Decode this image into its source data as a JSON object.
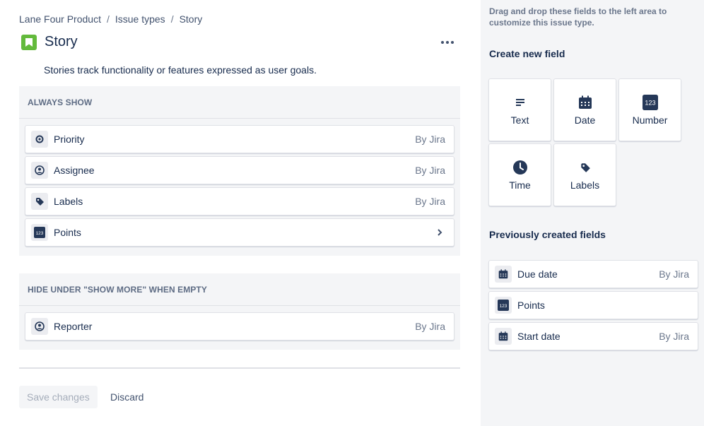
{
  "breadcrumb": {
    "items": [
      "Lane Four Product",
      "Issue types",
      "Story"
    ],
    "separator": "/"
  },
  "header": {
    "title": "Story",
    "description": "Stories track functionality or features expressed as user goals."
  },
  "always_show": {
    "heading": "ALWAYS SHOW",
    "fields": [
      {
        "name": "Priority",
        "meta": "By Jira",
        "icon": "priority-icon"
      },
      {
        "name": "Assignee",
        "meta": "By Jira",
        "icon": "user-icon"
      },
      {
        "name": "Labels",
        "meta": "By Jira",
        "icon": "label-icon"
      },
      {
        "name": "Points",
        "meta": "",
        "icon": "number-icon"
      }
    ]
  },
  "hide_section": {
    "heading": "HIDE UNDER \"SHOW MORE\" WHEN EMPTY",
    "fields": [
      {
        "name": "Reporter",
        "meta": "By Jira",
        "icon": "user-icon"
      }
    ]
  },
  "actions": {
    "save": "Save changes",
    "discard": "Discard"
  },
  "sidebar": {
    "hint": "Drag and drop these fields to the left area to customize this issue type.",
    "create_heading": "Create new field",
    "create_types": [
      {
        "label": "Text",
        "icon": "text-icon"
      },
      {
        "label": "Date",
        "icon": "calendar-icon"
      },
      {
        "label": "Number",
        "icon": "number-icon",
        "badge": "123"
      },
      {
        "label": "Time",
        "icon": "clock-icon"
      },
      {
        "label": "Labels",
        "icon": "label-icon"
      }
    ],
    "previous_heading": "Previously created fields",
    "previous_fields": [
      {
        "name": "Due date",
        "meta": "By Jira",
        "icon": "calendar-icon"
      },
      {
        "name": "Points",
        "meta": "",
        "icon": "number-icon"
      },
      {
        "name": "Start date",
        "meta": "By Jira",
        "icon": "calendar-icon"
      }
    ]
  },
  "colors": {
    "story_green": "#63ba3c",
    "dark_navy": "#253858",
    "panel_bg": "#f4f5f7",
    "text": "#172b4d",
    "muted": "#6b778c"
  }
}
